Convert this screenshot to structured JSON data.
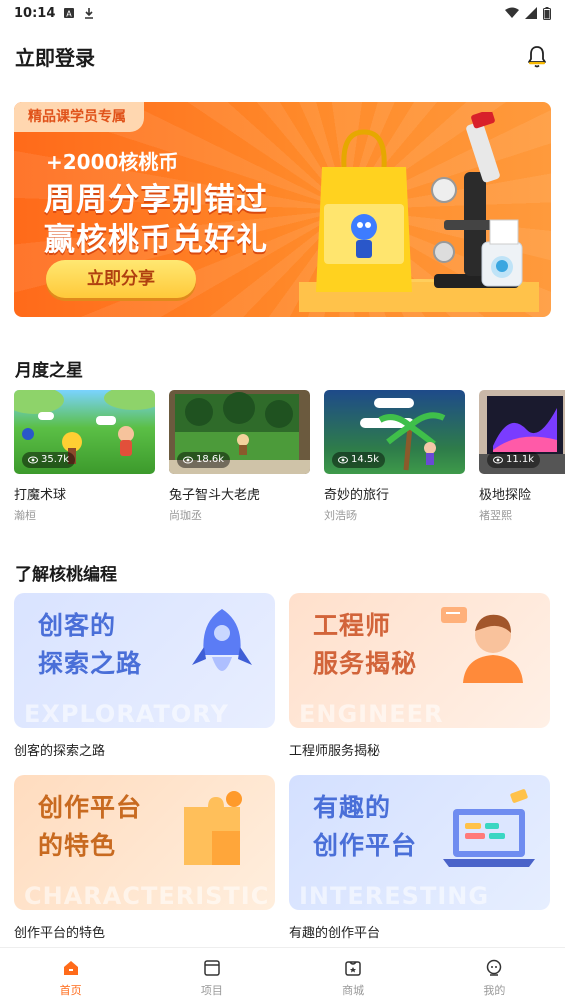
{
  "status_bar": {
    "time": "10:14"
  },
  "header": {
    "login_label": "立即登录",
    "bell_icon": "bell-icon"
  },
  "banner": {
    "tag": "精品课学员专属",
    "line1": "+2000核桃币",
    "line2": "周周分享别错过",
    "line3": "赢核桃币兑好礼",
    "button": "立即分享"
  },
  "monthly_stars": {
    "title": "月度之星",
    "items": [
      {
        "title": "打魔术球",
        "author": "瀚桓",
        "views": "35.7k"
      },
      {
        "title": "兔子智斗大老虎",
        "author": "尚珈丞",
        "views": "18.6k"
      },
      {
        "title": "奇妙的旅行",
        "author": "刘浩旸",
        "views": "14.5k"
      },
      {
        "title": "极地探险",
        "author": "褚翌熙",
        "views": "11.1k"
      }
    ]
  },
  "learn": {
    "title": "了解核桃编程",
    "cards": [
      {
        "big1": "创客的",
        "big2": "探索之路",
        "watermark": "EXPLORATORY",
        "caption": "创客的探索之路"
      },
      {
        "big1": "工程师",
        "big2": "服务揭秘",
        "watermark": "ENGINEER",
        "caption": "工程师服务揭秘"
      },
      {
        "big1": "创作平台",
        "big2": "的特色",
        "watermark": "CHARACTERISTIC",
        "caption": "创作平台的特色"
      },
      {
        "big1": "有趣的",
        "big2": "创作平台",
        "watermark": "INTERESTING",
        "caption": "有趣的创作平台"
      }
    ]
  },
  "bottom_nav": {
    "items": [
      {
        "label": "首页",
        "icon": "home-icon",
        "active": true
      },
      {
        "label": "项目",
        "icon": "project-icon",
        "active": false
      },
      {
        "label": "商城",
        "icon": "store-icon",
        "active": false
      },
      {
        "label": "我的",
        "icon": "profile-icon",
        "active": false
      }
    ]
  },
  "colors": {
    "accent": "#ff6b1a",
    "banner": "#ff7a20",
    "blue_card": "#dde6ff",
    "orange_card": "#ffe6d6"
  }
}
